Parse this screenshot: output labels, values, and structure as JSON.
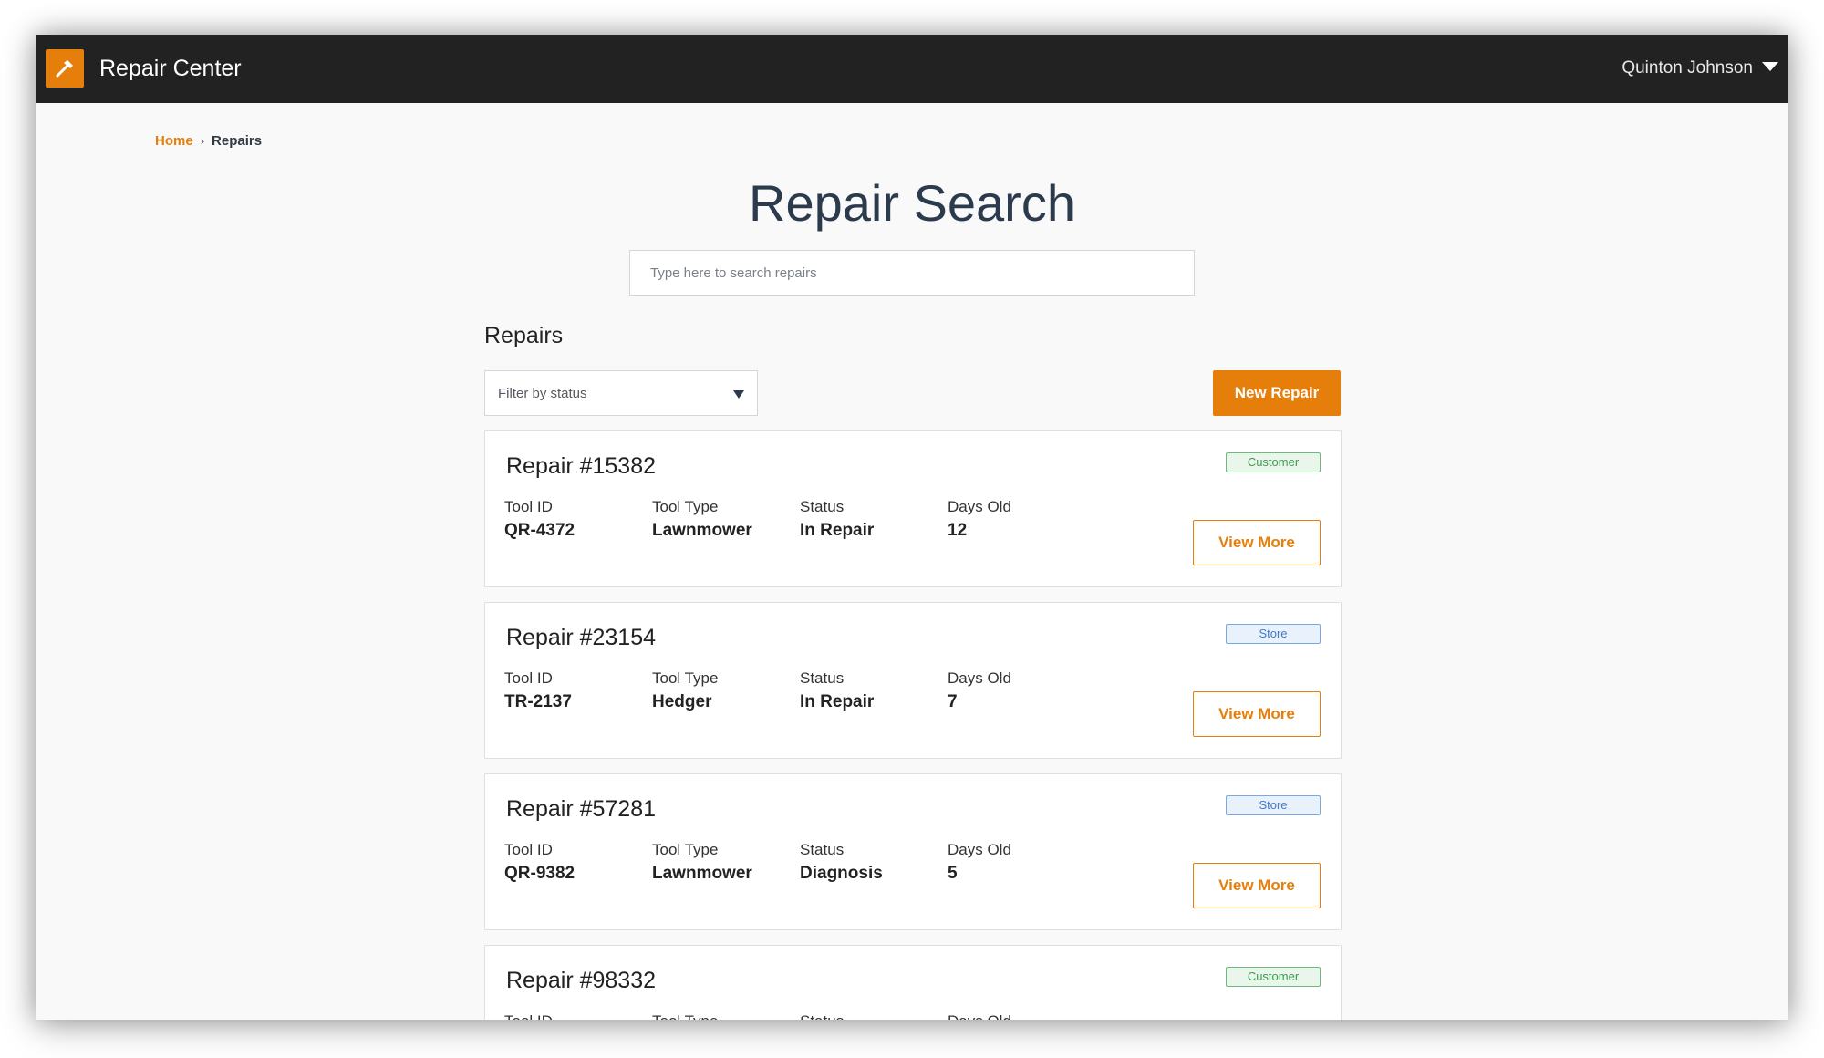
{
  "header": {
    "app_title": "Repair Center",
    "logo_icon": "hammer-icon",
    "user_name": "Quinton Johnson",
    "accent_color": "#e67e0c",
    "bar_color": "#222222"
  },
  "breadcrumb": {
    "home": "Home",
    "current": "Repairs"
  },
  "page": {
    "title": "Repair Search"
  },
  "search": {
    "placeholder": "Type here to search repairs",
    "value": ""
  },
  "repairs": {
    "section_title": "Repairs",
    "filter_placeholder": "Filter by status",
    "new_button_label": "New Repair",
    "field_labels": {
      "tool_id": "Tool ID",
      "tool_type": "Tool Type",
      "status": "Status",
      "days_old": "Days Old"
    },
    "view_more_label": "View More",
    "items": [
      {
        "title": "Repair #15382",
        "badge": "Customer",
        "tool_id": "QR-4372",
        "tool_type": "Lawnmower",
        "status": "In Repair",
        "days_old": "12"
      },
      {
        "title": "Repair #23154",
        "badge": "Store",
        "tool_id": "TR-2137",
        "tool_type": "Hedger",
        "status": "In Repair",
        "days_old": "7"
      },
      {
        "title": "Repair #57281",
        "badge": "Store",
        "tool_id": "QR-9382",
        "tool_type": "Lawnmower",
        "status": "Diagnosis",
        "days_old": "5"
      },
      {
        "title": "Repair #98332",
        "badge": "Customer",
        "tool_id": "",
        "tool_type": "",
        "status": "",
        "days_old": ""
      }
    ]
  }
}
